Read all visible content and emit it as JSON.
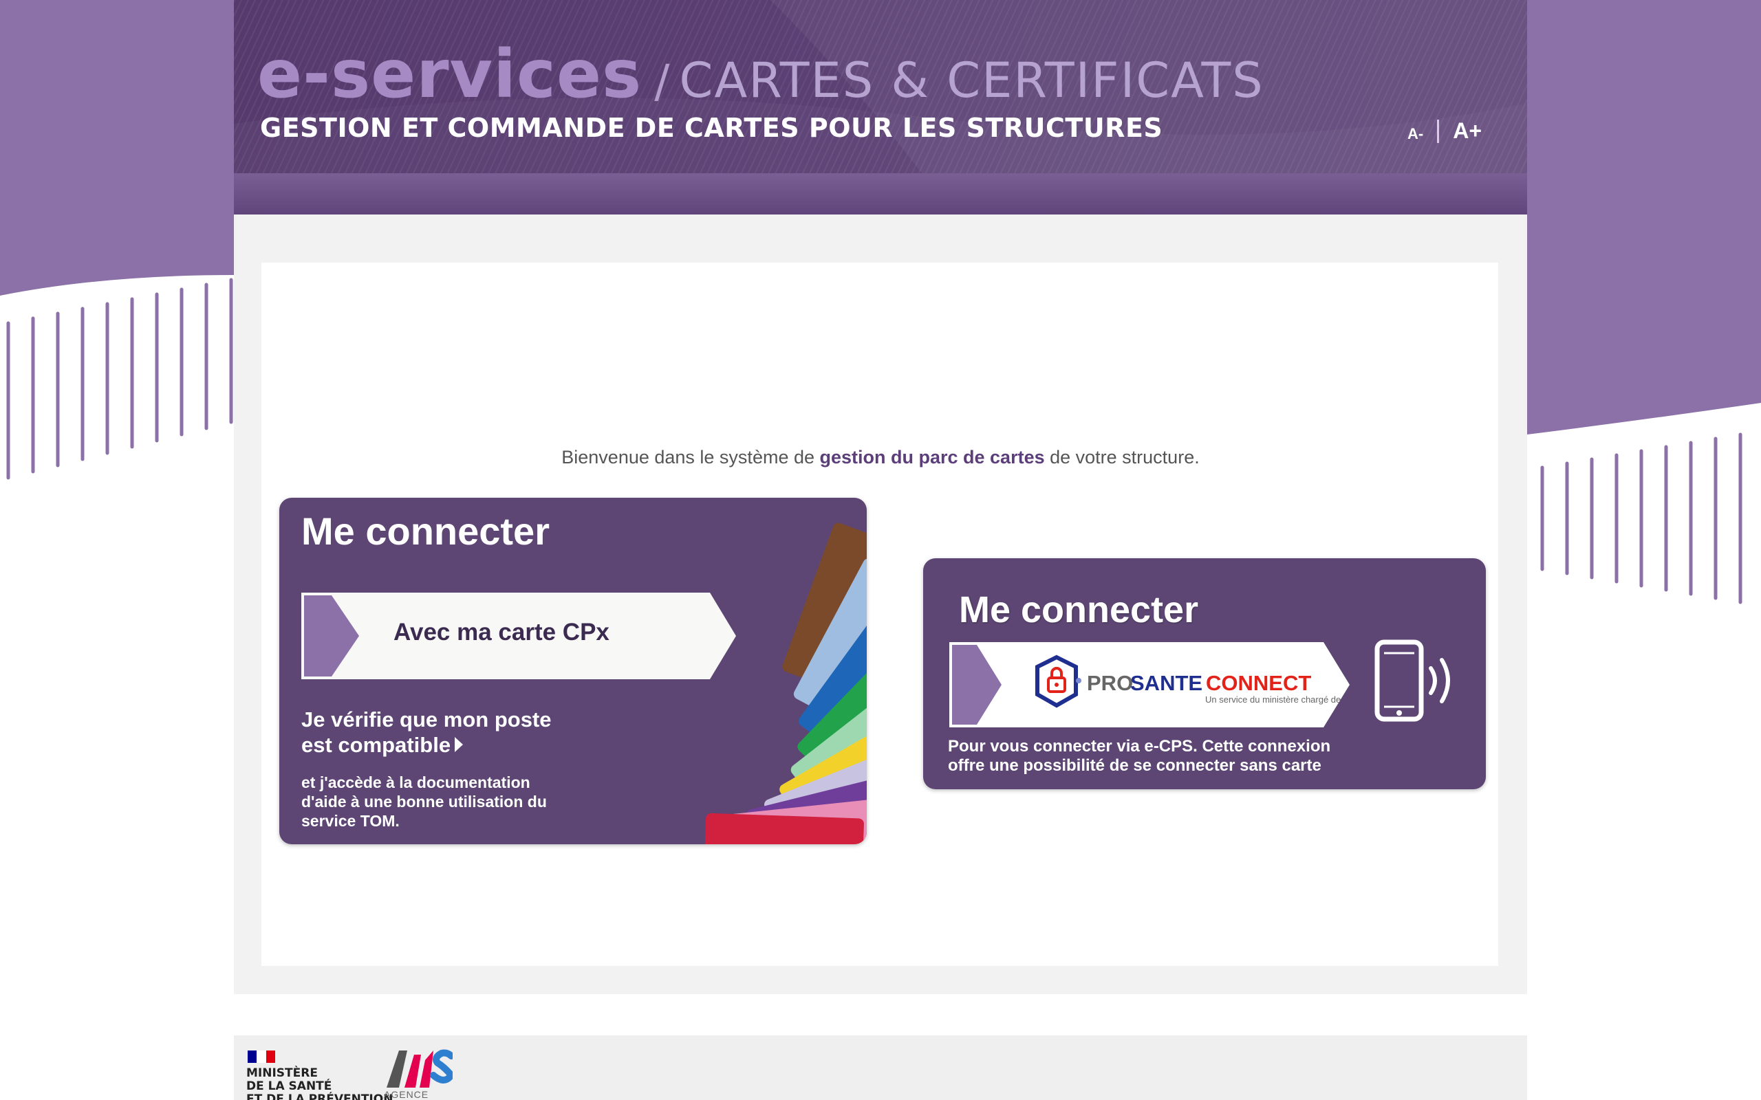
{
  "header": {
    "brand_eservices": "e-services",
    "brand_sep": "/",
    "brand_cartes": "CARTES & CERTIFICATS",
    "subtitle": "GESTION ET COMMANDE DE CARTES POUR LES STRUCTURES",
    "font_decrease": "A-",
    "font_increase": "A+"
  },
  "welcome": {
    "before": "Bienvenue dans le système de ",
    "highlight": "gestion du parc de cartes",
    "after": " de votre structure."
  },
  "card_cpx": {
    "title": "Me connecter",
    "button_label": "Avec ma carte CPx",
    "check_line1": "Je vérifie que mon poste",
    "check_line2": "est compatible",
    "doc_text": "et j'accède à la documentation d'aide à une bonne utilisation du service TOM."
  },
  "card_psc": {
    "title": "Me connecter",
    "logo_pro": "PRO",
    "logo_sante": "SANTE",
    "logo_connect": "CONNECT",
    "logo_tagline": "Un service du ministère chargé de la Santé",
    "description": "Pour vous connecter via e-CPS. Cette connexion offre une possibilité de se connecter sans carte"
  },
  "footer": {
    "ministry_line1": "MINISTÈRE",
    "ministry_line2": "DE LA SANTÉ",
    "ministry_line3": "ET DE LA PRÉVENTION",
    "ans_caption": "AGENCE"
  },
  "icons": [
    "lock-shield-icon",
    "smartphone-nfc-icon",
    "caret-right-icon",
    "chevron-arrow-icon"
  ],
  "colors": {
    "primary_purple": "#5d4674",
    "accent_purple": "#8b71a8",
    "background_gray": "#f2f2f2"
  }
}
